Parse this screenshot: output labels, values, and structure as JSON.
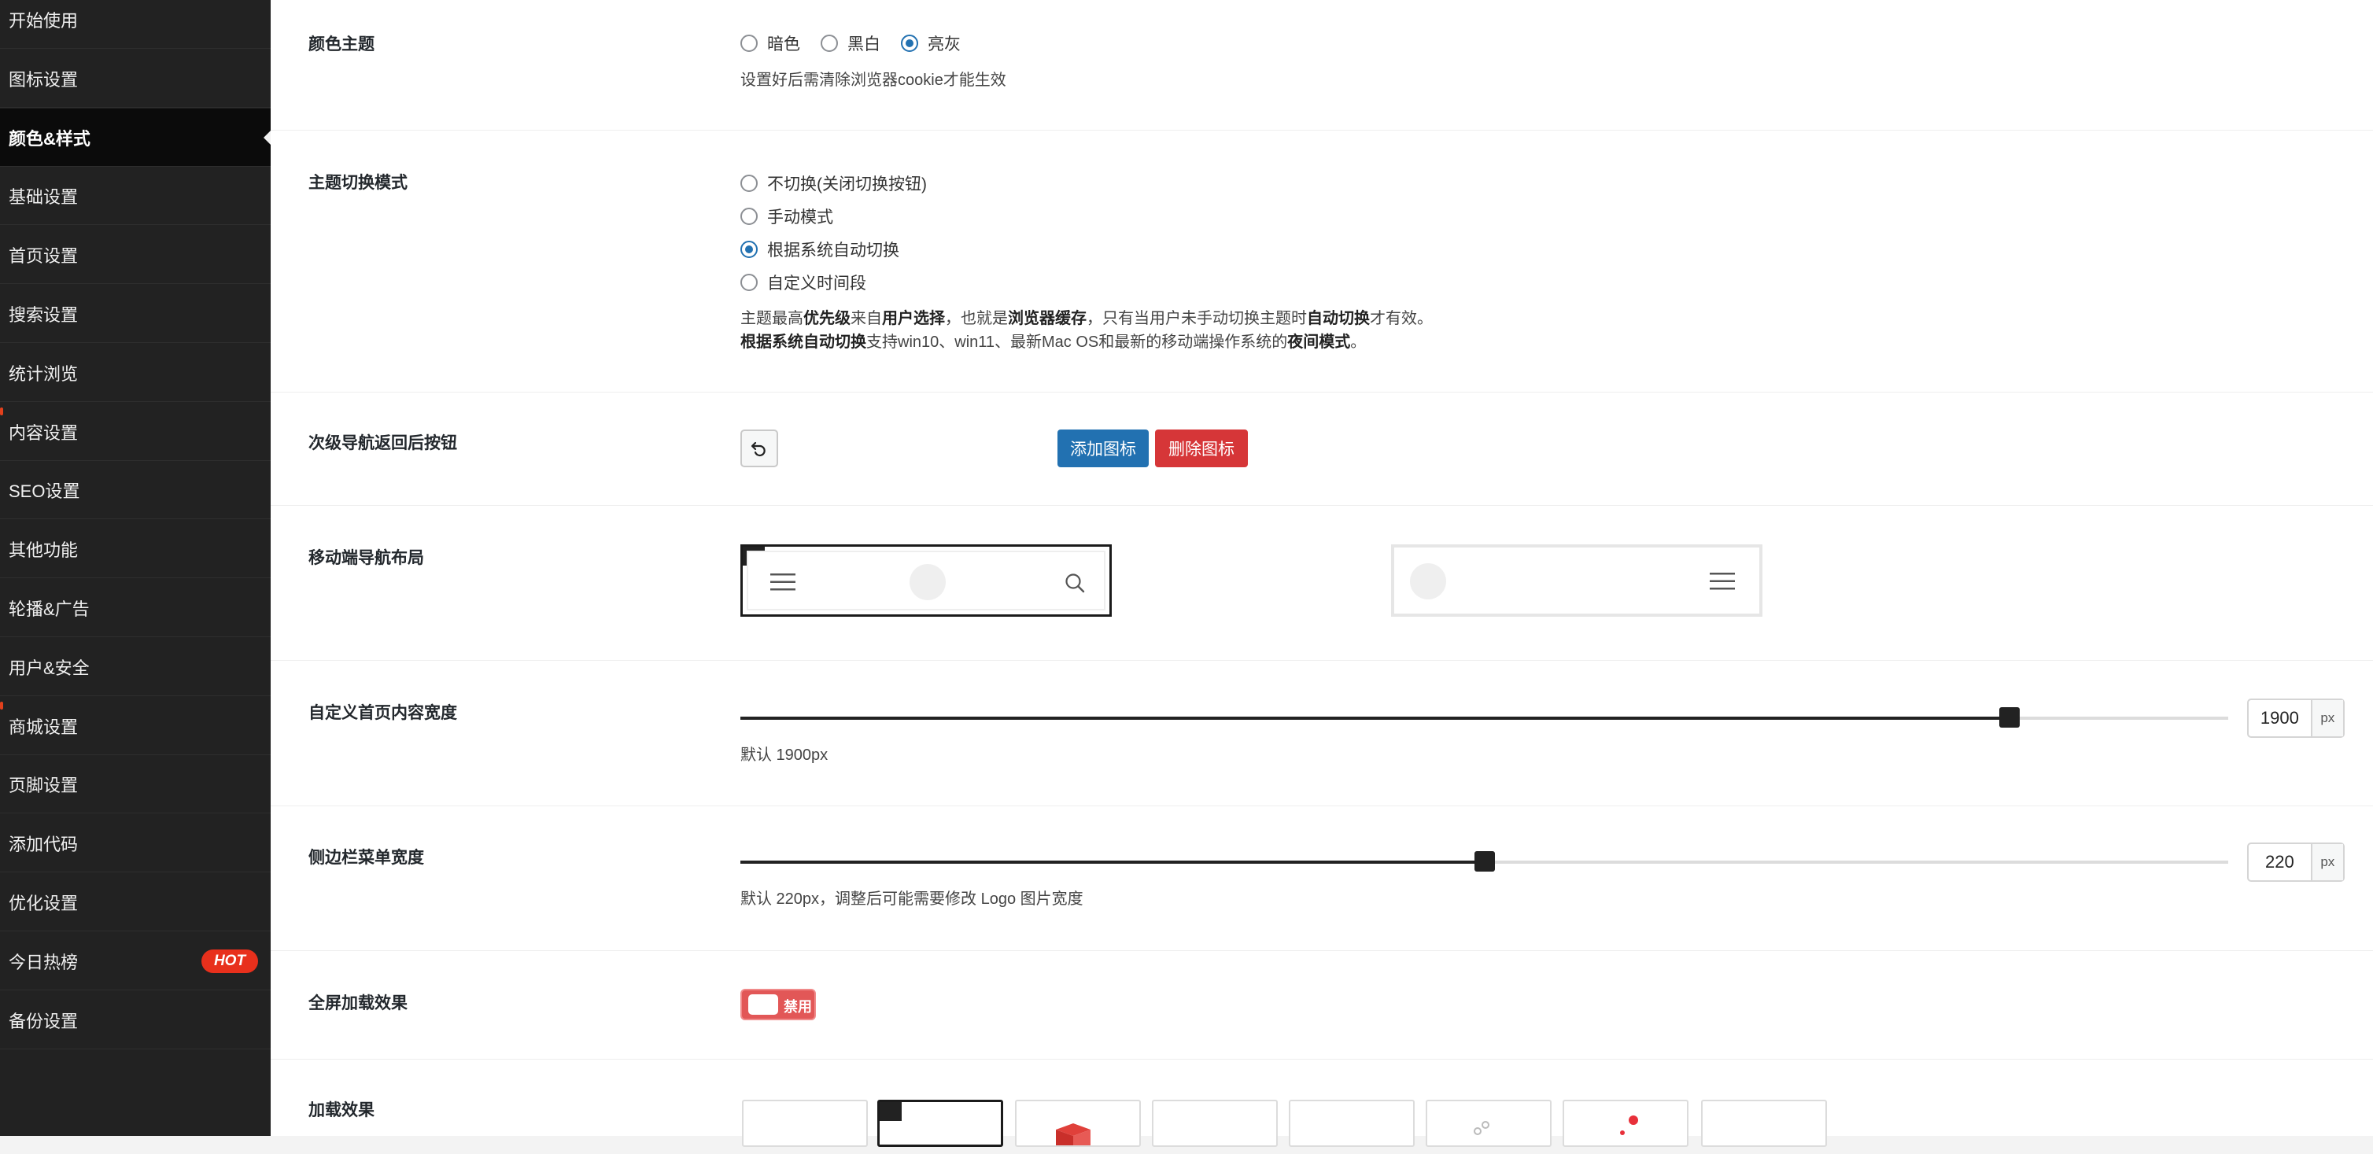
{
  "sidebar": {
    "items": [
      {
        "label": "开始使用",
        "active": false,
        "marker": false
      },
      {
        "label": "图标设置",
        "active": false,
        "marker": false
      },
      {
        "label": "颜色&样式",
        "active": true,
        "marker": false
      },
      {
        "label": "基础设置",
        "active": false,
        "marker": false
      },
      {
        "label": "首页设置",
        "active": false,
        "marker": false
      },
      {
        "label": "搜索设置",
        "active": false,
        "marker": false
      },
      {
        "label": "统计浏览",
        "active": false,
        "marker": false
      },
      {
        "label": "内容设置",
        "active": false,
        "marker": true
      },
      {
        "label": "SEO设置",
        "active": false,
        "marker": false
      },
      {
        "label": "其他功能",
        "active": false,
        "marker": false
      },
      {
        "label": "轮播&广告",
        "active": false,
        "marker": false
      },
      {
        "label": "用户&安全",
        "active": false,
        "marker": false
      },
      {
        "label": "商城设置",
        "active": false,
        "marker": true
      },
      {
        "label": "页脚设置",
        "active": false,
        "marker": false
      },
      {
        "label": "添加代码",
        "active": false,
        "marker": false
      },
      {
        "label": "优化设置",
        "active": false,
        "marker": false
      },
      {
        "label": "今日热榜",
        "active": false,
        "marker": false,
        "badge": "HOT"
      },
      {
        "label": "备份设置",
        "active": false,
        "marker": false
      }
    ]
  },
  "color_theme": {
    "title": "颜色主题",
    "options": [
      {
        "label": "暗色",
        "checked": false
      },
      {
        "label": "黑白",
        "checked": false
      },
      {
        "label": "亮灰",
        "checked": true
      }
    ],
    "description": "设置好后需清除浏览器cookie才能生效"
  },
  "theme_switch": {
    "title": "主题切换模式",
    "options": [
      {
        "label": "不切换(关闭切换按钮)",
        "checked": false
      },
      {
        "label": "手动模式",
        "checked": false
      },
      {
        "label": "根据系统自动切换",
        "checked": true
      },
      {
        "label": "自定义时间段",
        "checked": false
      }
    ],
    "desc_line1": {
      "t1": "主题最高",
      "b1": "优先级",
      "t2": "来自",
      "b2": "用户选择",
      "t3": "，也就是",
      "b3": "浏览器缓存",
      "t4": "，只有当用户未手动切换主题时",
      "b4": "自动切换",
      "t5": "才有效。"
    },
    "desc_line2": {
      "b1": "根据系统自动切换",
      "t1": "支持win10、win11、最新Mac OS和最新的移动端操作系统的",
      "b2": "夜间模式",
      "t2": "。"
    }
  },
  "sub_nav_back": {
    "title": "次级导航返回后按钮",
    "add_label": "添加图标",
    "delete_label": "删除图标",
    "reset_icon": "undo-icon"
  },
  "mobile_nav_layout": {
    "title": "移动端导航布局",
    "selected_index": 0,
    "layouts": [
      "menu-left-search-right",
      "logo-left-menu-right"
    ]
  },
  "home_content_width": {
    "title": "自定义首页内容宽度",
    "value": "1900",
    "unit": "px",
    "level": 0.853,
    "note": "默认 1900px"
  },
  "sidebar_menu_width": {
    "title": "侧边栏菜单宽度",
    "value": "220",
    "unit": "px",
    "level": 0.5,
    "note": "默认 220px，调整后可能需要修改 Logo 图片宽度"
  },
  "fullscreen_loading": {
    "title": "全屏加载效果",
    "toggle_label": "禁用",
    "enabled": false
  },
  "loading_effect": {
    "title": "加载效果",
    "selected_index": 1,
    "count": 8
  },
  "colors": {
    "sidebar_bg": "#222222",
    "accent": "#2271b1",
    "danger": "#d63638",
    "hot": "#e8301c"
  }
}
